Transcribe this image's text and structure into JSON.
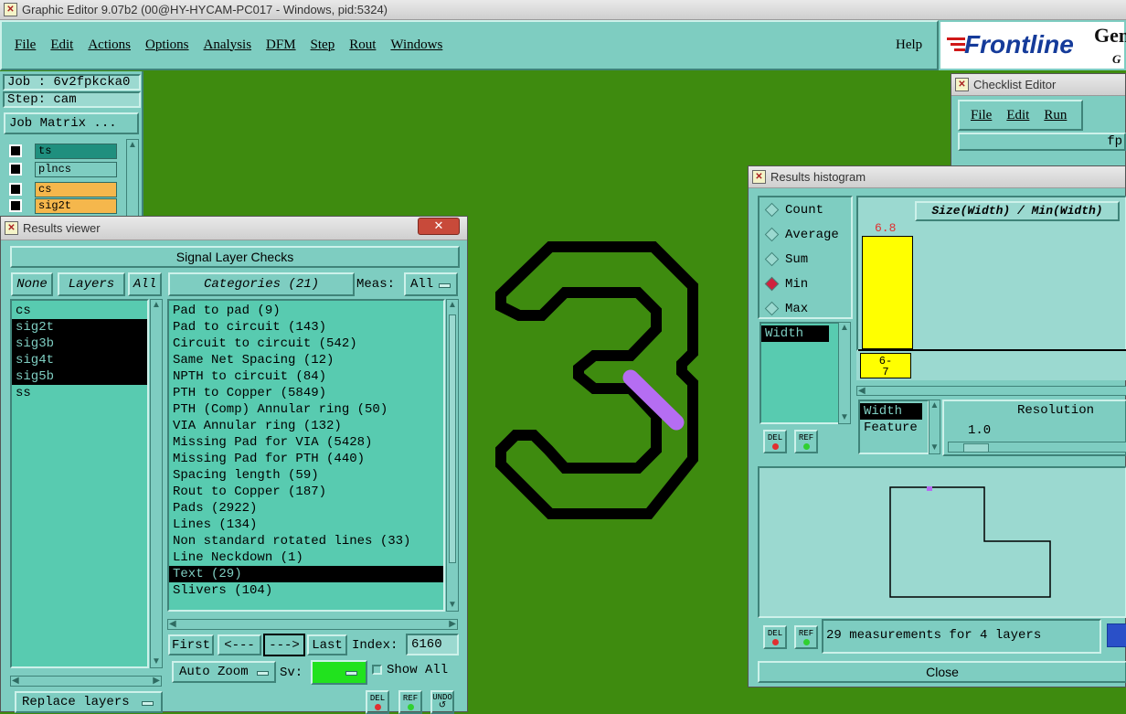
{
  "app": {
    "title": "Graphic Editor 9.07b2 (00@HY-HYCAM-PC017 - Windows, pid:5324)",
    "menu": [
      "File",
      "Edit",
      "Actions",
      "Options",
      "Analysis",
      "DFM",
      "Step",
      "Rout",
      "Windows"
    ],
    "help": "Help",
    "logo_text": "Frontline",
    "logo_partial": "Gen",
    "logo_partial2": "G"
  },
  "job_panel": {
    "job": "Job : 6v2fpkcka0",
    "step": "Step: cam",
    "job_matrix": "Job Matrix ...",
    "layers": [
      {
        "name": "ts",
        "color": "#1f8f7e"
      },
      {
        "name": "plncs",
        "color": "#7ecdc1"
      },
      {
        "name": "cs",
        "color": "#f5b74c"
      },
      {
        "name": "sig2t",
        "color": "#f5b74c"
      }
    ]
  },
  "canvas": {
    "glyph": "3",
    "board_color": "#3e8b0f",
    "marker_color": "#b56df2"
  },
  "results_viewer": {
    "title": "Results viewer",
    "header": "Signal Layer Checks",
    "none_btn": "None",
    "layers_btn": "Layers",
    "all_btn": "All",
    "categories_btn": "Categories (21)",
    "meas_label": "Meas:",
    "meas_value": "All",
    "layer_list": [
      {
        "name": "cs",
        "selected": false
      },
      {
        "name": "sig2t",
        "selected": true
      },
      {
        "name": "sig3b",
        "selected": true
      },
      {
        "name": "sig4t",
        "selected": true
      },
      {
        "name": "sig5b",
        "selected": true
      },
      {
        "name": "ss",
        "selected": false
      }
    ],
    "categories": [
      {
        "name": "Pad to pad (9)",
        "selected": false
      },
      {
        "name": "Pad to circuit (143)",
        "selected": false
      },
      {
        "name": "Circuit to circuit (542)",
        "selected": false
      },
      {
        "name": "Same Net Spacing (12)",
        "selected": false
      },
      {
        "name": "NPTH to circuit (84)",
        "selected": false
      },
      {
        "name": "PTH to Copper (5849)",
        "selected": false
      },
      {
        "name": "PTH (Comp) Annular ring (50)",
        "selected": false
      },
      {
        "name": "VIA Annular ring (132)",
        "selected": false
      },
      {
        "name": "Missing Pad for VIA (5428)",
        "selected": false
      },
      {
        "name": "Missing Pad for PTH (440)",
        "selected": false
      },
      {
        "name": "Spacing length (59)",
        "selected": false
      },
      {
        "name": "Rout to Copper (187)",
        "selected": false
      },
      {
        "name": "Pads (2922)",
        "selected": false
      },
      {
        "name": "Lines (134)",
        "selected": false
      },
      {
        "name": "Non standard rotated lines (33)",
        "selected": false
      },
      {
        "name": "Line Neckdown (1)",
        "selected": false
      },
      {
        "name": "Text (29)",
        "selected": true
      },
      {
        "name": "Slivers (104)",
        "selected": false
      }
    ],
    "first_btn": "First",
    "prev_btn": "<---",
    "next_btn": "--->",
    "last_btn": "Last",
    "index_label": "Index:",
    "index_value": "6160",
    "auto_zoom": "Auto Zoom",
    "sv_label": "Sv:",
    "show_all": "Show All",
    "replace_layers": "Replace layers",
    "del": "DEL",
    "ref": "REF",
    "undo": "UNDO"
  },
  "checklist_editor": {
    "title": "Checklist Editor",
    "menu": [
      "File",
      "Edit",
      "Run"
    ],
    "partial": "fp"
  },
  "histogram": {
    "title": "Results histogram",
    "options": [
      {
        "label": "Count",
        "selected": false
      },
      {
        "label": "Average",
        "selected": false
      },
      {
        "label": "Sum",
        "selected": false
      },
      {
        "label": "Min",
        "selected": true
      },
      {
        "label": "Max",
        "selected": false
      }
    ],
    "list_item": "Width",
    "ratio_label": "Size(Width) / Min(Width)",
    "bar_value": "6.8",
    "bar_bin": "6-\n7",
    "width_label": "Width",
    "feature_label": "Feature",
    "resolution_label": "Resolution",
    "resolution_value": "1.0",
    "status": "29 measurements for 4 layers",
    "close": "Close",
    "del": "DEL",
    "ref": "REF"
  }
}
